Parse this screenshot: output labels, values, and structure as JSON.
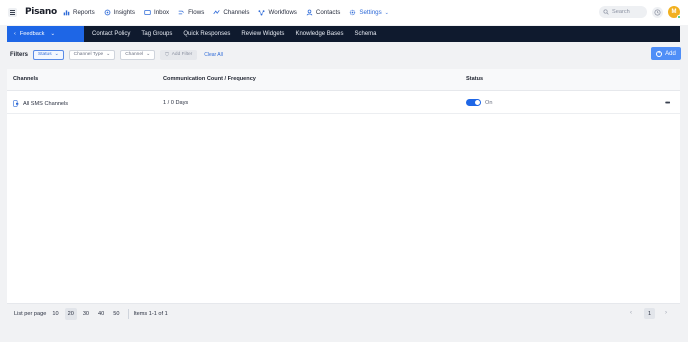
{
  "brand": {
    "logo": "Pisano",
    "avatar_initial": "M"
  },
  "nav": {
    "items": [
      {
        "label": "Reports",
        "icon": "bar-chart-icon"
      },
      {
        "label": "Insights",
        "icon": "insights-icon"
      },
      {
        "label": "Inbox",
        "icon": "inbox-icon"
      },
      {
        "label": "Flows",
        "icon": "flows-icon"
      },
      {
        "label": "Channels",
        "icon": "channels-icon"
      },
      {
        "label": "Workflows",
        "icon": "workflows-icon"
      },
      {
        "label": "Contacts",
        "icon": "contacts-icon"
      },
      {
        "label": "Settings",
        "icon": "gear-icon",
        "active": true
      }
    ],
    "search_placeholder": "Search"
  },
  "subnav": {
    "section": "Feedback",
    "tabs": [
      "Contact Policy",
      "Tag Groups",
      "Quick Responses",
      "Review Widgets",
      "Knowledge Bases",
      "Schema"
    ]
  },
  "filters": {
    "label": "Filters",
    "chips": [
      "Status",
      "Channel Type",
      "Channel"
    ],
    "add_filter": "Add Filter",
    "clear_all": "Clear All",
    "add_button": "Add"
  },
  "table": {
    "columns": [
      "Channels",
      "Communication Count / Frequency",
      "Status"
    ],
    "rows": [
      {
        "channel": "All SMS Channels",
        "frequency": "1 / 0 Days",
        "status": "On"
      }
    ]
  },
  "pagination": {
    "label": "List per page",
    "sizes": [
      "10",
      "20",
      "30",
      "40",
      "50"
    ],
    "selected_size": "20",
    "items_text": "Items 1-1 of 1",
    "current_page": "1"
  },
  "colors": {
    "accent": "#1e66e6",
    "subnav_bg": "#0f1a2e",
    "avatar": "#f2b01e"
  }
}
